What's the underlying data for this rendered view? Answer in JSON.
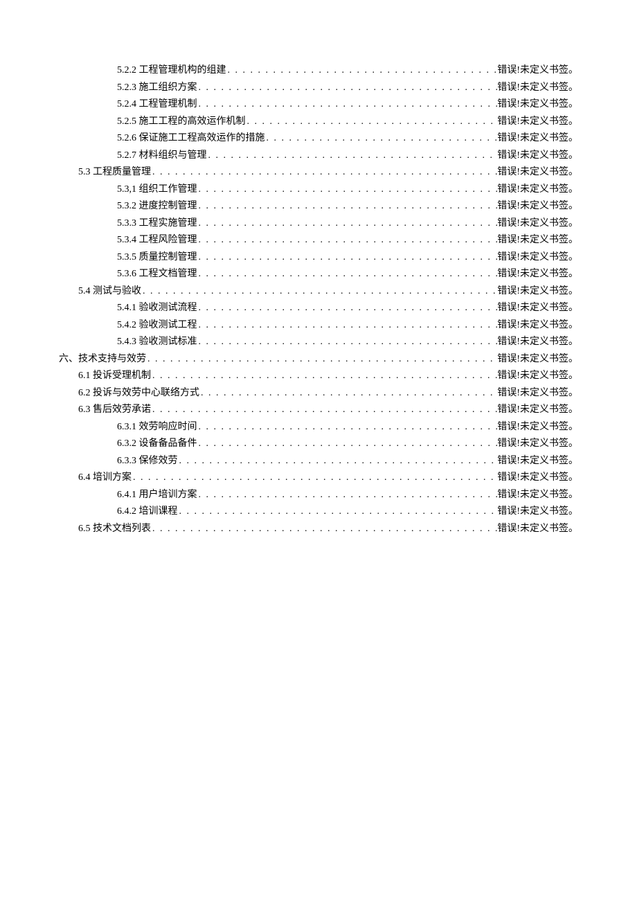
{
  "error_text": "错误!未定义书签。",
  "entries": [
    {
      "level": 3,
      "title": "5.2.2 工程管理机构的组建"
    },
    {
      "level": 3,
      "title": "5.2.3 施工组织方案"
    },
    {
      "level": 3,
      "title": "5.2.4 工程管理机制"
    },
    {
      "level": 3,
      "title": "5.2.5 施工工程的高效运作机制"
    },
    {
      "level": 3,
      "title": "5.2.6 保证施工工程高效运作的措施"
    },
    {
      "level": 3,
      "title": "5.2.7 材料组织与管理"
    },
    {
      "level": 2,
      "title": "5.3 工程质量管理"
    },
    {
      "level": 3,
      "title": "5.3,1 组织工作管理"
    },
    {
      "level": 3,
      "title": "5.3.2 进度控制管理"
    },
    {
      "level": 3,
      "title": "5.3.3 工程实施管理"
    },
    {
      "level": 3,
      "title": "5.3.4 工程风险管理"
    },
    {
      "level": 3,
      "title": "5.3.5 质量控制管理"
    },
    {
      "level": 3,
      "title": "5.3.6 工程文档管理"
    },
    {
      "level": 2,
      "title": "5.4 测试与验收"
    },
    {
      "level": 3,
      "title": "5.4.1 验收测试流程"
    },
    {
      "level": 3,
      "title": "5.4.2 验收测试工程"
    },
    {
      "level": 3,
      "title": "5.4.3 验收测试标准"
    },
    {
      "level": 1,
      "title": "六、技术支持与效劳"
    },
    {
      "level": 2,
      "title": "6.1 投诉受理机制"
    },
    {
      "level": 2,
      "title": "6.2 投诉与效劳中心联络方式"
    },
    {
      "level": 2,
      "title": "6.3 售后效劳承诺"
    },
    {
      "level": 3,
      "title": "6.3.1 效劳响应时间"
    },
    {
      "level": 3,
      "title": "6.3.2 设备备品备件"
    },
    {
      "level": 3,
      "title": "6.3.3 保修效劳"
    },
    {
      "level": 2,
      "title": "6.4 培训方案"
    },
    {
      "level": 3,
      "title": "6.4.1 用户培训方案"
    },
    {
      "level": 3,
      "title": "6.4.2 培训课程"
    },
    {
      "level": 2,
      "title": "6.5 技术文档列表"
    }
  ]
}
